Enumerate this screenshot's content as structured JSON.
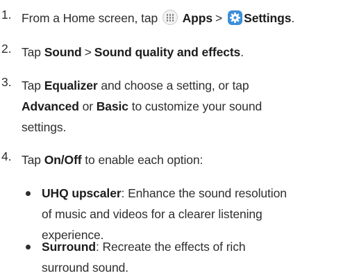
{
  "steps": [
    {
      "num": "1.",
      "pre": "From a Home screen, tap ",
      "apps": "Apps",
      "sep": ">",
      "settings": "Settings",
      "end": "."
    },
    {
      "num": "2.",
      "pre": "Tap ",
      "sound": "Sound",
      "sep": ">",
      "sqe": "Sound quality and effects",
      "end": "."
    },
    {
      "num": "3.",
      "l1_pre": "Tap ",
      "equalizer": "Equalizer",
      "l1_post": " and choose a setting, or tap",
      "advanced": "Advanced",
      "or": " or ",
      "basic": "Basic",
      "l2_post": " to customize your sound",
      "l3": "settings."
    },
    {
      "num": "4.",
      "pre": "Tap ",
      "onoff": "On/Off",
      "post": " to enable each option:"
    }
  ],
  "bullets": [
    {
      "term": "UHQ upscaler",
      "l1": ": Enhance the sound resolution",
      "l2": "of music and videos for a clearer listening",
      "l3": "experience."
    },
    {
      "term": "Surround",
      "l1": ": Recreate the effects of rich",
      "l2": "surround sound."
    }
  ],
  "icons": {
    "apps": "apps-grid-icon",
    "settings": "settings-gear-icon",
    "settings_color": "#3d8fd9"
  }
}
